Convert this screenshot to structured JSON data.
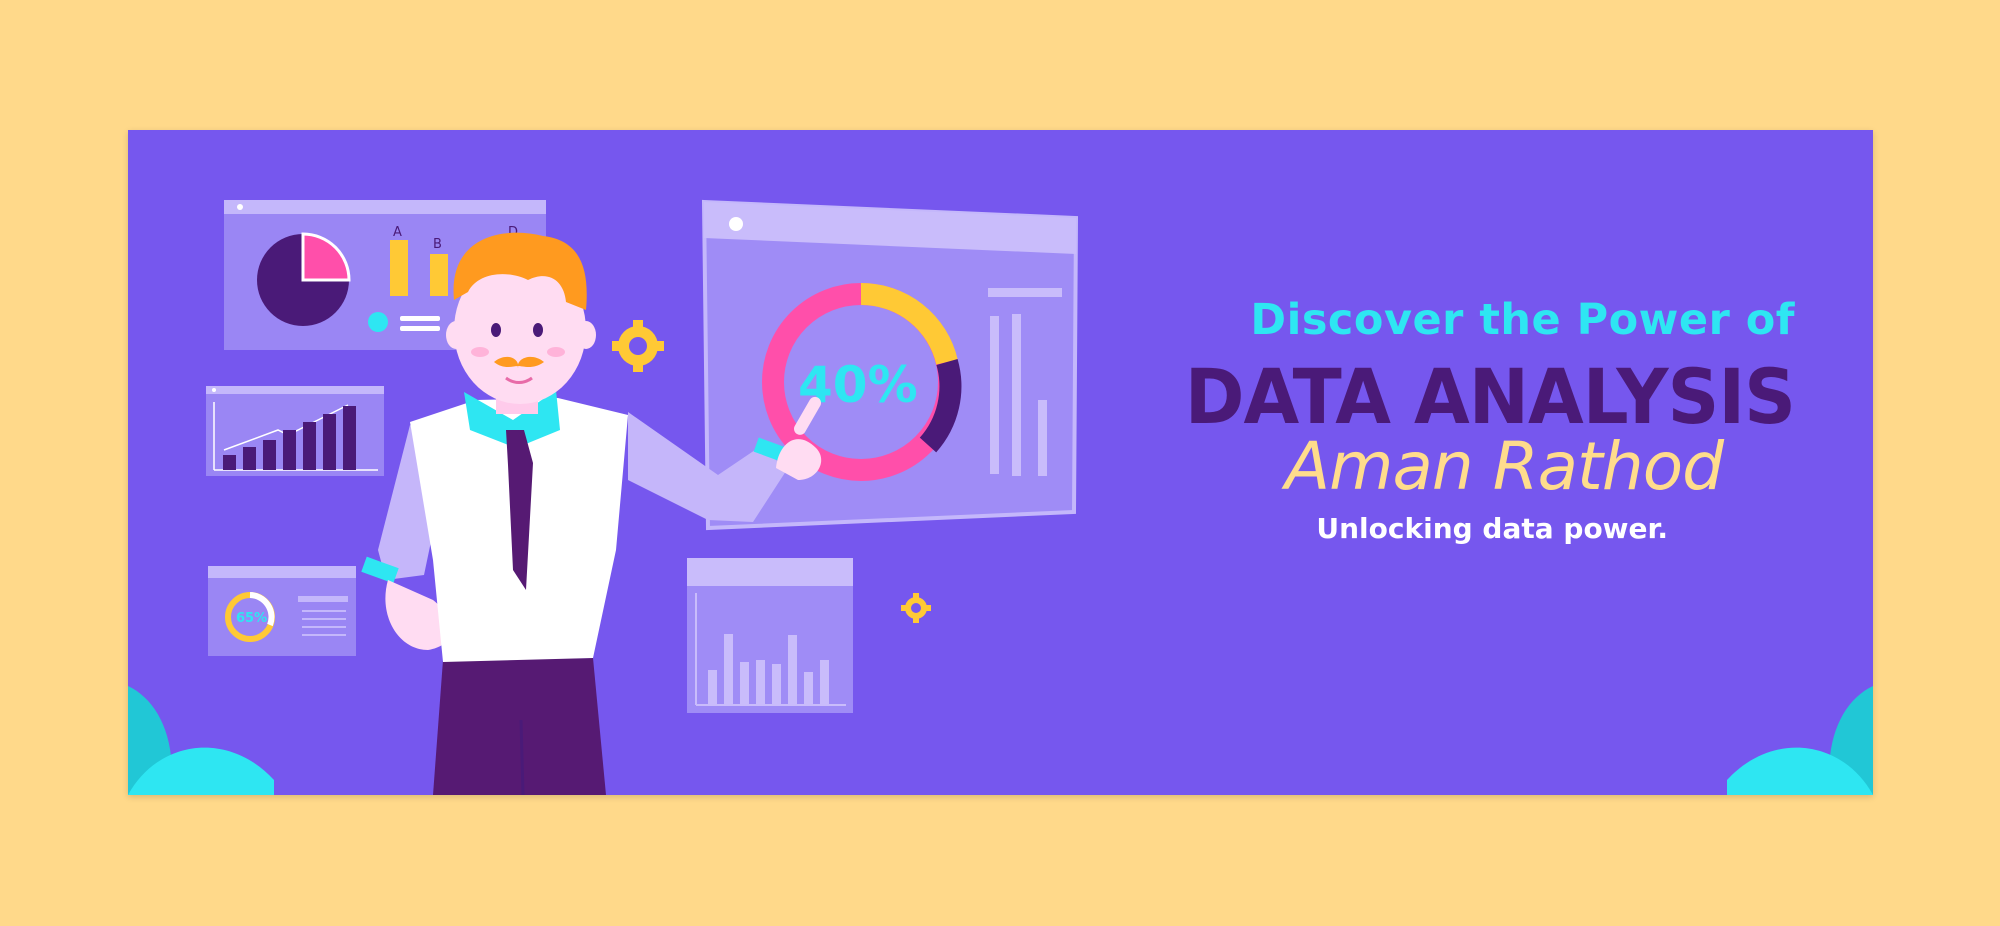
{
  "banner": {
    "kicker": "Discover the Power of",
    "headline": "DATA ANALYSIS",
    "author": "Aman Rathod",
    "tagline": "Unlocking data power."
  },
  "panels": {
    "big_donut_label": "40%",
    "small_donut_label": "65%",
    "bar_letters": [
      "A",
      "B",
      "D"
    ]
  },
  "colors": {
    "background": "#FFD98A",
    "banner": "#7657EE",
    "kicker": "#2EE6F2",
    "headline": "#4A1A78",
    "author": "#FFDC8C",
    "tagline": "#FFFFFF"
  }
}
